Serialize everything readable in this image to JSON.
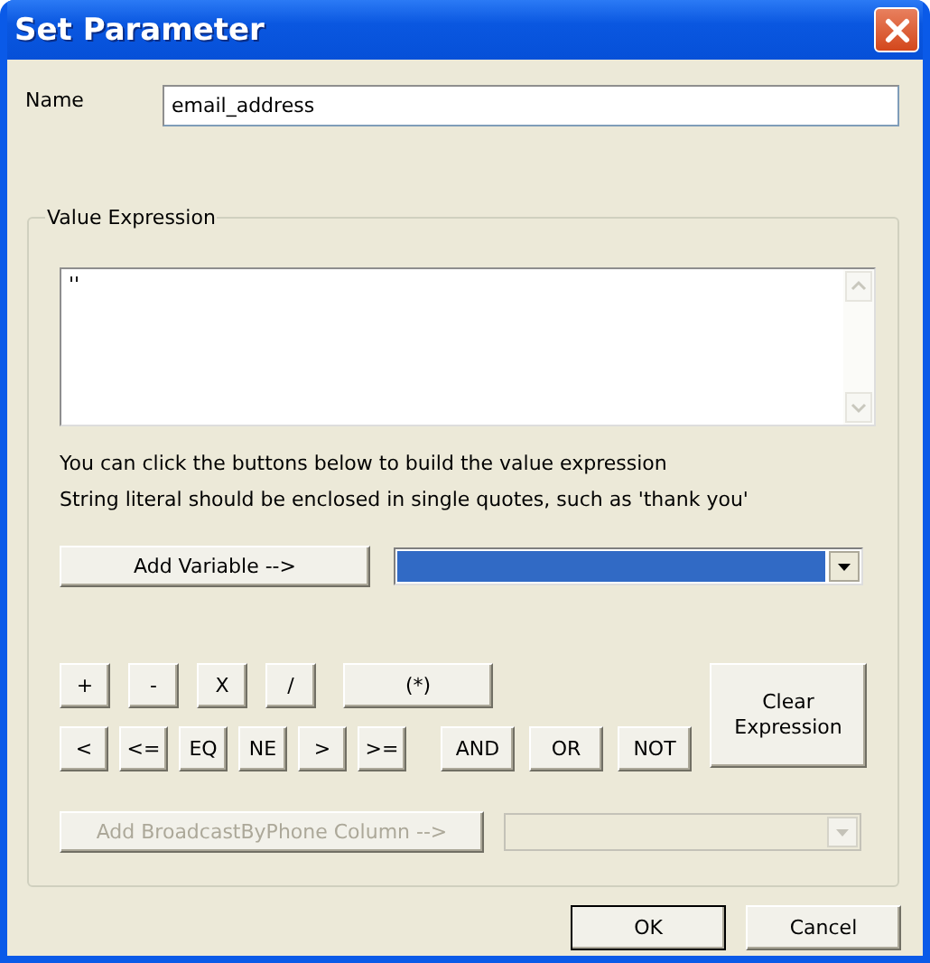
{
  "window": {
    "title": "Set Parameter"
  },
  "name_field": {
    "label": "Name",
    "value": "email_address"
  },
  "value_expression": {
    "legend": "Value Expression",
    "expression": "''",
    "hints": [
      "You can click the buttons below to build the value expression",
      "String literal should be enclosed in single quotes, such as 'thank you'"
    ],
    "add_variable": {
      "label": "Add Variable -->",
      "disabled": false
    },
    "variable_dropdown": {
      "focused": true,
      "disabled": false
    },
    "operators": {
      "arithmetic": [
        "+",
        "-",
        "X",
        "/"
      ],
      "grouping": "(*)",
      "comparison": [
        "<",
        "<=",
        "EQ",
        "NE",
        ">",
        ">="
      ],
      "logical": [
        "AND",
        "OR",
        "NOT"
      ]
    },
    "clear_button": {
      "label": "Clear Expression"
    },
    "add_column": {
      "label": "Add BroadcastByPhone Column -->",
      "disabled": true
    },
    "column_dropdown": {
      "focused": false,
      "disabled": true
    }
  },
  "buttons": [
    {
      "label": "OK",
      "default": true
    },
    {
      "label": "Cancel",
      "default": false
    }
  ]
}
